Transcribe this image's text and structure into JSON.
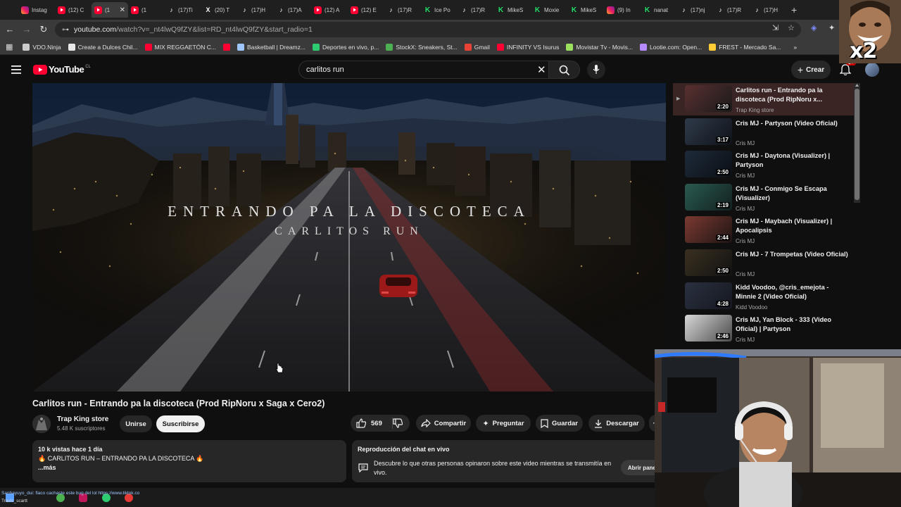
{
  "browser": {
    "tabs": [
      {
        "icon": "instagram",
        "label": "Instag"
      },
      {
        "icon": "youtube",
        "label": "(12) C"
      },
      {
        "icon": "youtube",
        "label": "(1",
        "active": true
      },
      {
        "icon": "youtube",
        "label": "(1"
      },
      {
        "icon": "tiktok",
        "label": "(17)Ti"
      },
      {
        "icon": "x",
        "label": "(20) T"
      },
      {
        "icon": "tiktok",
        "label": "(17)H"
      },
      {
        "icon": "tiktok",
        "label": "(17)A"
      },
      {
        "icon": "youtube",
        "label": "(12) A"
      },
      {
        "icon": "youtube",
        "label": "(12) E"
      },
      {
        "icon": "tiktok",
        "label": "(17)R"
      },
      {
        "icon": "kick",
        "label": "Ice Po"
      },
      {
        "icon": "tiktok",
        "label": "(17)R"
      },
      {
        "icon": "kick",
        "label": "MikeS"
      },
      {
        "icon": "kick",
        "label": "Moxie"
      },
      {
        "icon": "kick",
        "label": "MikeS"
      },
      {
        "icon": "instagram",
        "label": "(9) In"
      },
      {
        "icon": "kick",
        "label": "nanat"
      },
      {
        "icon": "tiktok",
        "label": "(17)nj"
      },
      {
        "icon": "tiktok",
        "label": "(17)R"
      },
      {
        "icon": "tiktok",
        "label": "(17)H"
      }
    ],
    "new_tab": "+",
    "url_host": "youtube.com",
    "url_path": "/watch?v=_nt4lwQ9fZY&list=RD_nt4lwQ9fZY&start_radio=1",
    "bookmarks": [
      {
        "label": "VDO.Ninja",
        "color": "#cccccc"
      },
      {
        "label": "Create a Dulces Chil...",
        "color": "#e8e8e8"
      },
      {
        "label": "MIX REGGAETÓN C...",
        "color": "#ff0033"
      },
      {
        "label": "",
        "color": "#ff0033"
      },
      {
        "label": "Basketball | Dreamz...",
        "color": "#9ec7ff"
      },
      {
        "label": "Deportes en vivo, p...",
        "color": "#2ecc71"
      },
      {
        "label": "StockX: Sneakers, St...",
        "color": "#4caf50"
      },
      {
        "label": "Gmail",
        "color": "#ea4335"
      },
      {
        "label": "INFINITY VS Isurus",
        "color": "#ff0033"
      },
      {
        "label": "Movistar Tv - Movis...",
        "color": "#9be15d"
      },
      {
        "label": "Lootie.com: Open...",
        "color": "#b68aff"
      },
      {
        "label": "FREST - Mercado Sa...",
        "color": "#ffcc33"
      }
    ],
    "bookmarks_more": "»"
  },
  "youtube": {
    "logo_text": "YouTube",
    "logo_country": "CL",
    "search_query": "carlitos run",
    "create_label": "Crear",
    "notifications_badge": "9+"
  },
  "player": {
    "title_overlay": "ENTRANDO PA LA DISCOTECA",
    "subtitle_overlay": "CARLITOS RUN"
  },
  "video": {
    "title": "Carlitos run - Entrando pa la discoteca (Prod RipNoru x Saga x Cero2)",
    "channel": "Trap King store",
    "subscribers": "5.48 K suscriptores",
    "join_label": "Unirse",
    "subscribe_label": "Suscribirse",
    "likes": "569",
    "share_label": "Compartir",
    "ask_label": "Preguntar",
    "save_label": "Guardar",
    "download_label": "Descargar",
    "description": {
      "stats": "10 k vistas  hace 1 día",
      "line1": "🔥 CARLITOS RUN – ENTRANDO PA LA DISCOTECA 🔥",
      "more": "...más"
    },
    "chat_replay": {
      "title": "Reproducción del chat en vivo",
      "text": "Descubre lo que otras personas opinaron sobre este video mientras se transmitía en vivo.",
      "button": "Abrir panel"
    }
  },
  "playlist": [
    {
      "title": "Carlitos run - Entrando pa la discoteca (Prod RipNoru x...",
      "channel": "Trap King store",
      "duration": "2:20",
      "active": true
    },
    {
      "title": "Cris MJ - Partyson (Video Oficial)",
      "channel": "Cris MJ",
      "duration": "3:17"
    },
    {
      "title": "Cris MJ - Daytona (Visualizer) | Partyson",
      "channel": "Cris MJ",
      "duration": "2:50"
    },
    {
      "title": "Cris MJ - Conmigo Se Escapa (Visualizer)",
      "channel": "Cris MJ",
      "duration": "2:19"
    },
    {
      "title": "Cris MJ - Maybach (Visualizer) | Apocalipsis",
      "channel": "Cris MJ",
      "duration": "2:44"
    },
    {
      "title": "Cris MJ - 7 Trompetas (Video Oficial)",
      "channel": "Cris MJ",
      "duration": "2:50"
    },
    {
      "title": "Kidd Voodoo, @cris_emejota - Minnie 2 (Video Oficial)",
      "channel": "Kidd Voodoo",
      "duration": "4:28"
    },
    {
      "title": "Cris MJ, Yan Block - 333 (Video Oficial) | Partyson",
      "channel": "Cris MJ",
      "duration": "2:46"
    }
  ],
  "overlay": {
    "chat_line": "Sanhayuyo_dui: flaco cachaste este bug del lol https://www.tiktok.co",
    "chat_line2": "Travis_scartt",
    "meme_badge": "x2"
  },
  "colors": {
    "youtube_red": "#ff0033",
    "background": "#0f0f0f",
    "active_playlist_bg": "#3a2424"
  }
}
